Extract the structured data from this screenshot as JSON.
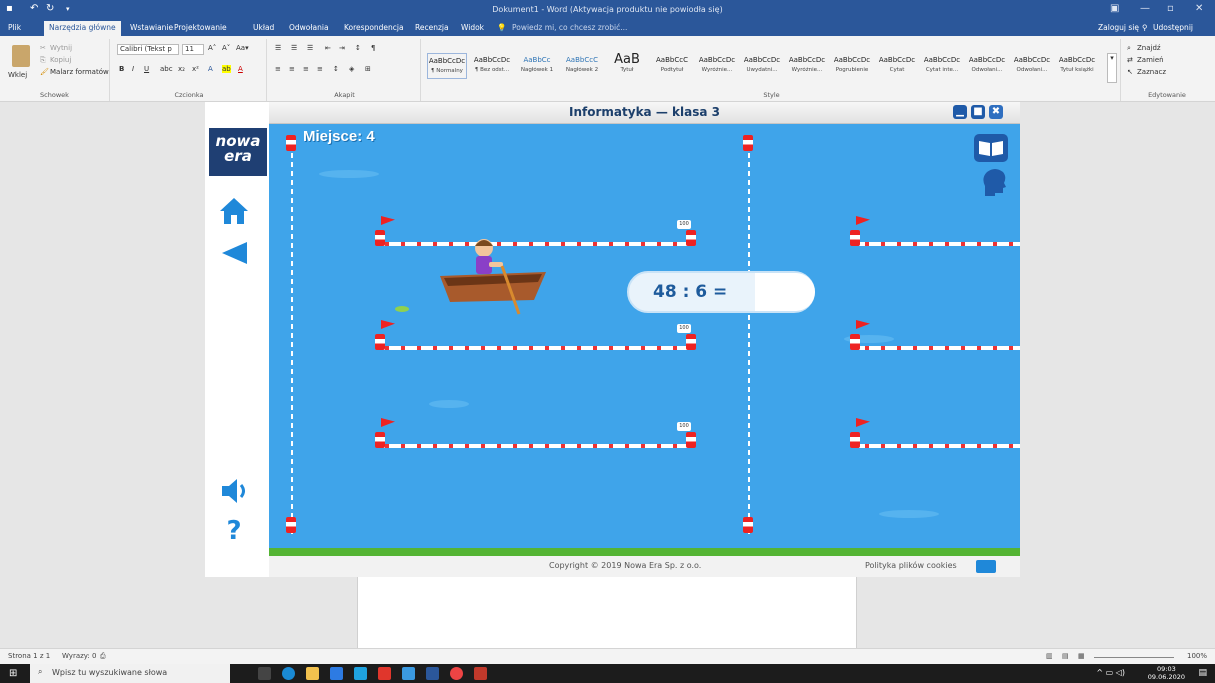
{
  "window": {
    "title": "Dokument1 - Word (Aktywacja produktu nie powiodła się)",
    "quick_access": [
      "save-icon",
      "undo-icon",
      "redo-icon"
    ],
    "controls": [
      "ribbon-display-icon",
      "minimize-icon",
      "maximize-icon",
      "close-icon"
    ]
  },
  "tabs": [
    {
      "label": "Plik"
    },
    {
      "label": "Narzędzia główne"
    },
    {
      "label": "Wstawianie"
    },
    {
      "label": "Projektowanie"
    },
    {
      "label": "Układ"
    },
    {
      "label": "Odwołania"
    },
    {
      "label": "Korespondencja"
    },
    {
      "label": "Recenzja"
    },
    {
      "label": "Widok"
    }
  ],
  "tellme": "Powiedz mi, co chcesz zrobić...",
  "account": {
    "signin": "Zaloguj się",
    "share": "Udostępnij"
  },
  "ribbon": {
    "clipboard": {
      "paste": "Wklej",
      "cut": "Wytnij",
      "copy": "Kopiuj",
      "painter": "Malarz formatów",
      "label": "Schowek"
    },
    "font": {
      "name": "Calibri (Tekst p",
      "size": "11",
      "label": "Czcionka"
    },
    "paragraph": {
      "label": "Akapit"
    },
    "styles": {
      "label": "Style",
      "items": [
        {
          "sample": "AaBbCcDc",
          "name": "¶ Normalny"
        },
        {
          "sample": "AaBbCcDc",
          "name": "¶ Bez odst..."
        },
        {
          "sample": "AaBbCc",
          "name": "Nagłówek 1"
        },
        {
          "sample": "AaBbCcC",
          "name": "Nagłówek 2"
        },
        {
          "sample": "AaB",
          "name": "Tytuł"
        },
        {
          "sample": "AaBbCcC",
          "name": "Podtytuł"
        },
        {
          "sample": "AaBbCcDc",
          "name": "Wyróżnie..."
        },
        {
          "sample": "AaBbCcDc",
          "name": "Uwydatni..."
        },
        {
          "sample": "AaBbCcDc",
          "name": "Wyróżnie..."
        },
        {
          "sample": "AaBbCcDc",
          "name": "Pogrubienie"
        },
        {
          "sample": "AaBbCcDc",
          "name": "Cytat"
        },
        {
          "sample": "AaBbCcDc",
          "name": "Cytat inte..."
        },
        {
          "sample": "AaBbCcDc",
          "name": "Odwołani..."
        },
        {
          "sample": "AaBbCcDc",
          "name": "Odwołani..."
        },
        {
          "sample": "AaBbCcDc",
          "name": "Tytuł książki"
        }
      ]
    },
    "editing": {
      "find": "Znajdź",
      "replace": "Zamień",
      "select": "Zaznacz",
      "label": "Edytowanie"
    }
  },
  "game": {
    "title": "Informatyka — klasa 3",
    "logo_line1": "nowa",
    "logo_line2": "era",
    "place": "Miejsce: 4",
    "question": "48 : 6 =",
    "answer": "",
    "badge": "100",
    "copyright": "Copyright © 2019 Nowa Era Sp. z o.o.",
    "cookies": "Polityka plików cookies",
    "help": "?"
  },
  "statusbar": {
    "page": "Strona 1 z 1",
    "words": "Wyrazy: 0",
    "zoom": "100%"
  },
  "taskbar": {
    "search_placeholder": "Wpisz tu wyszukiwane słowa",
    "time": "09:03",
    "date": "09.06.2020"
  }
}
